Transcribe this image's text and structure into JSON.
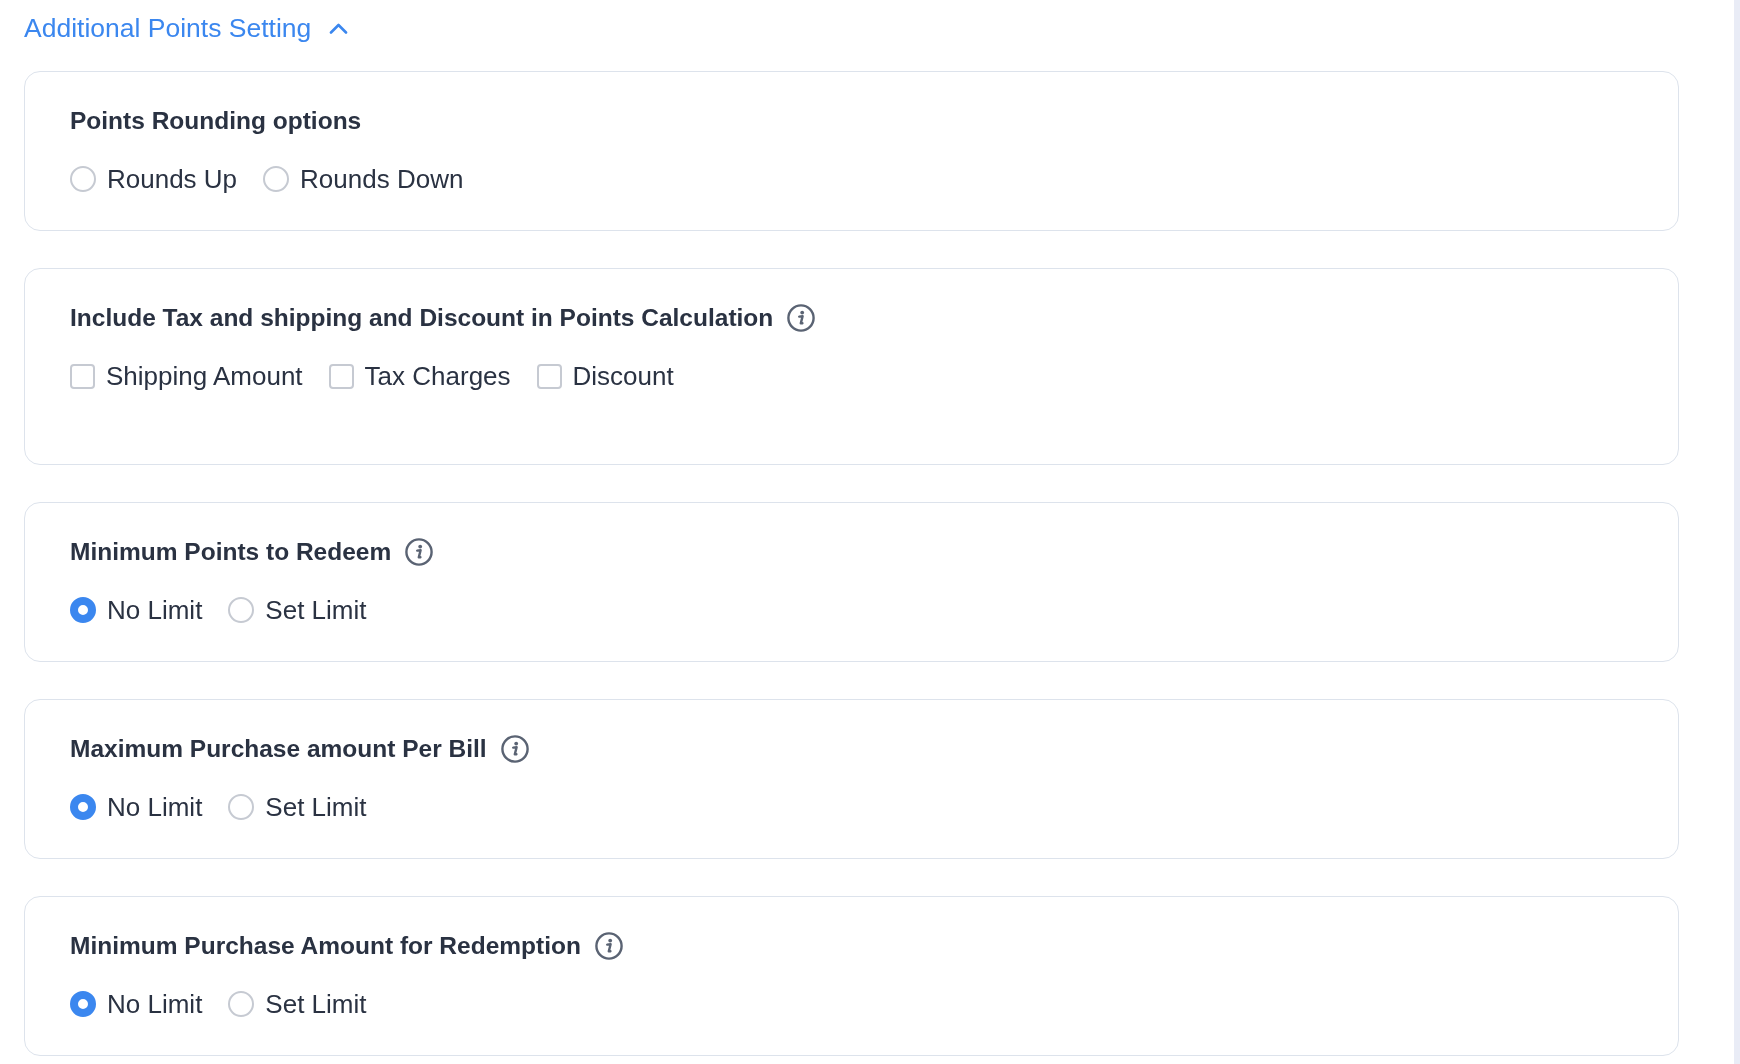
{
  "section": {
    "title": "Additional Points Setting",
    "expanded": true
  },
  "groups": [
    {
      "title": "Points Rounding options",
      "kind": "radio",
      "info": false,
      "options": [
        {
          "label": "Rounds Up",
          "selected": false
        },
        {
          "label": "Rounds Down",
          "selected": false
        }
      ]
    },
    {
      "title": "Include Tax and shipping and Discount in Points Calculation",
      "kind": "checkbox",
      "info": true,
      "options": [
        {
          "label": "Shipping Amount",
          "checked": false
        },
        {
          "label": "Tax Charges",
          "checked": false
        },
        {
          "label": "Discount",
          "checked": false
        }
      ]
    },
    {
      "title": "Minimum Points to Redeem",
      "kind": "radio",
      "info": true,
      "options": [
        {
          "label": "No Limit",
          "selected": true
        },
        {
          "label": "Set Limit",
          "selected": false
        }
      ]
    },
    {
      "title": "Maximum Purchase amount Per Bill",
      "kind": "radio",
      "info": true,
      "options": [
        {
          "label": "No Limit",
          "selected": true
        },
        {
          "label": "Set Limit",
          "selected": false
        }
      ]
    },
    {
      "title": "Minimum Purchase Amount for Redemption",
      "kind": "radio",
      "info": true,
      "options": [
        {
          "label": "No Limit",
          "selected": true
        },
        {
          "label": "Set Limit",
          "selected": false
        }
      ]
    }
  ]
}
